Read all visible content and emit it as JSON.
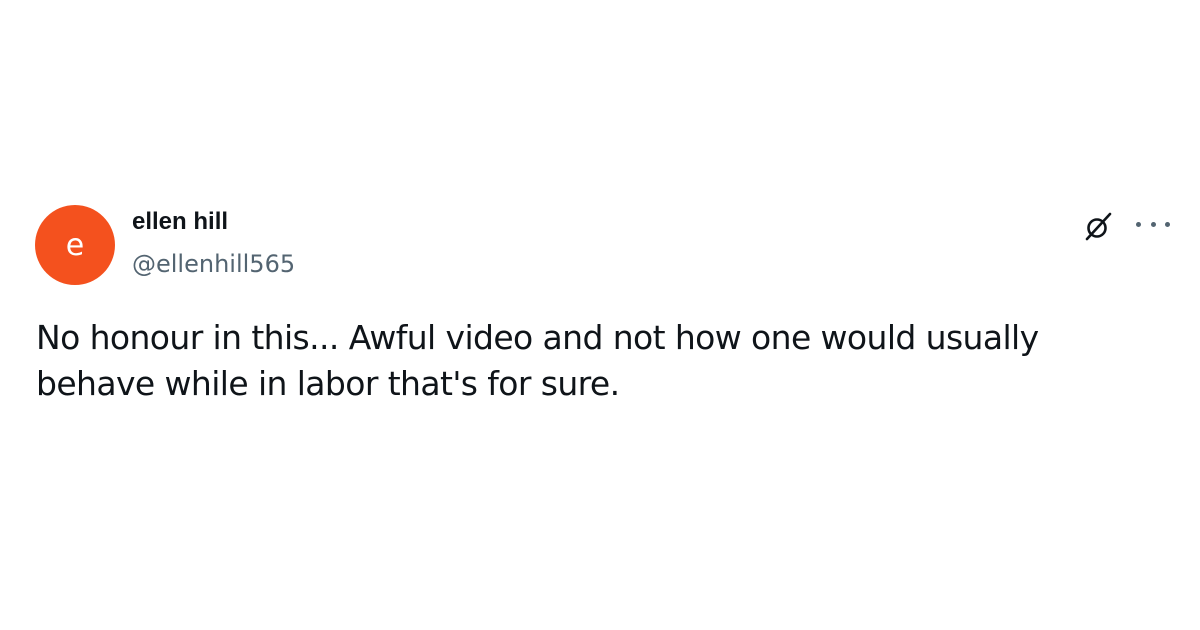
{
  "tweet": {
    "author": {
      "avatar_letter": "e",
      "avatar_color": "#f4511e",
      "display_name": "ellen hill",
      "handle": "@ellenhill565"
    },
    "icons": {
      "grok": "grok-icon",
      "more": "more-options-icon"
    },
    "text": "No honour in this... Awful video and not how one would usually behave while in labor that's for sure."
  }
}
